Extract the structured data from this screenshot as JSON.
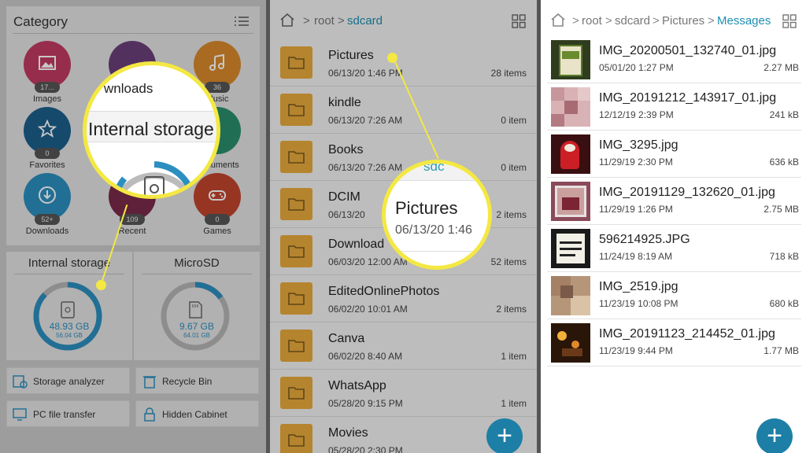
{
  "panel1": {
    "category_title": "Category",
    "categories": [
      {
        "label": "Images",
        "badge": "17...",
        "color": "#c23a63"
      },
      {
        "label": "Downloads",
        "badge": "",
        "color": "#6b3f7a"
      },
      {
        "label": "Music",
        "badge": "36",
        "color": "#d98a2b"
      },
      {
        "label": "Favorites",
        "badge": "0",
        "color": "#1d5f8c"
      },
      {
        "label": "Documents",
        "badge": "",
        "color": "#2a8f6c"
      },
      {
        "label": "Downloads",
        "badge": "52+",
        "color": "#2c8fbf"
      },
      {
        "label": "Recent",
        "badge": "109",
        "color": "#7a2a4a"
      },
      {
        "label": "Games",
        "badge": "0",
        "color": "#c2452e"
      }
    ],
    "internal_storage": {
      "title": "Internal storage",
      "used": "48.93 GB",
      "total": "56.04 GB",
      "fraction": 0.87
    },
    "microsd": {
      "title": "MicroSD",
      "used": "9.67 GB",
      "total": "64.01 GB",
      "fraction": 0.15
    },
    "tools": [
      {
        "label": "Storage analyzer",
        "icon": "storage-analyzer-icon"
      },
      {
        "label": "Recycle Bin",
        "icon": "recycle-bin-icon"
      },
      {
        "label": "PC file transfer",
        "icon": "pc-transfer-icon"
      },
      {
        "label": "Hidden Cabinet",
        "icon": "lock-icon"
      }
    ],
    "magnifier": {
      "partial_text": "wnloads",
      "zoom_text": "Internal storage"
    },
    "accent": "#f4e842"
  },
  "panel2": {
    "breadcrumb": [
      "root",
      "sdcard"
    ],
    "folders": [
      {
        "name": "Pictures",
        "date": "06/13/20 1:46 PM",
        "count": "28 items"
      },
      {
        "name": "kindle",
        "date": "06/13/20 7:26 AM",
        "count": "0 item"
      },
      {
        "name": "Books",
        "date": "06/13/20 7:26 AM",
        "count": "0 item"
      },
      {
        "name": "DCIM",
        "date": "06/13/20",
        "count": "2 items"
      },
      {
        "name": "Download",
        "date": "06/03/20 12:00 AM",
        "count": "52 items"
      },
      {
        "name": "EditedOnlinePhotos",
        "date": "06/02/20 10:01 AM",
        "count": "2 items"
      },
      {
        "name": "Canva",
        "date": "06/02/20 8:40 AM",
        "count": "1 item"
      },
      {
        "name": "WhatsApp",
        "date": "05/28/20 9:15 PM",
        "count": "1 item"
      },
      {
        "name": "Movies",
        "date": "05/28/20 2:30 PM",
        "count": ""
      }
    ],
    "magnifier": {
      "top_text": "sdc",
      "name": "Pictures",
      "date": "06/13/20 1:46"
    },
    "fab": "+"
  },
  "panel3": {
    "breadcrumb": [
      "root",
      "sdcard",
      "Pictures",
      "Messages"
    ],
    "files": [
      {
        "name": "IMG_20200501_132740_01.jpg",
        "date": "05/01/20 1:27 PM",
        "size": "2.27 MB"
      },
      {
        "name": "IMG_20191212_143917_01.jpg",
        "date": "12/12/19 2:39 PM",
        "size": "241 kB"
      },
      {
        "name": "IMG_3295.jpg",
        "date": "11/29/19 2:30 PM",
        "size": "636 kB"
      },
      {
        "name": "IMG_20191129_132620_01.jpg",
        "date": "11/29/19 1:26 PM",
        "size": "2.75 MB"
      },
      {
        "name": "596214925.JPG",
        "date": "11/24/19 8:19 AM",
        "size": "718 kB"
      },
      {
        "name": "IMG_2519.jpg",
        "date": "11/23/19 10:08 PM",
        "size": "680 kB"
      },
      {
        "name": "IMG_20191123_214452_01.jpg",
        "date": "11/23/19 9:44 PM",
        "size": "1.77 MB"
      }
    ],
    "fab": "+",
    "accent": "#1d8fb0"
  }
}
